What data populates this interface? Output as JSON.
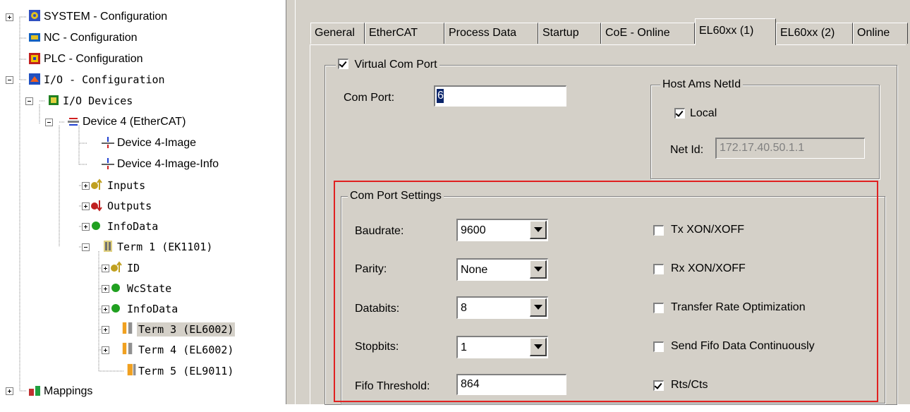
{
  "tree": {
    "items": [
      {
        "label": "SYSTEM - Configuration"
      },
      {
        "label": "NC - Configuration"
      },
      {
        "label": "PLC - Configuration"
      },
      {
        "label": "I/O - Configuration"
      },
      {
        "label": "I/O Devices"
      },
      {
        "label": "Device 4 (EtherCAT)"
      },
      {
        "label": "Device 4-Image"
      },
      {
        "label": "Device 4-Image-Info"
      },
      {
        "label": "Inputs"
      },
      {
        "label": "Outputs"
      },
      {
        "label": "InfoData"
      },
      {
        "label": "Term 1 (EK1101)"
      },
      {
        "label": "ID"
      },
      {
        "label": "WcState"
      },
      {
        "label": "InfoData"
      },
      {
        "label": "Term 3 (EL6002)"
      },
      {
        "label": "Term 4 (EL6002)"
      },
      {
        "label": "Term 5 (EL9011)"
      },
      {
        "label": "Mappings"
      }
    ]
  },
  "tabs": [
    "General",
    "EtherCAT",
    "Process Data",
    "Startup",
    "CoE - Online",
    "EL60xx (1)",
    "EL60xx (2)",
    "Online"
  ],
  "active_tab": "EL60xx (1)",
  "virtual_com_port": {
    "label": "Virtual Com Port",
    "checked": true
  },
  "com_port": {
    "label": "Com Port:",
    "value": "6"
  },
  "host_ams": {
    "title": "Host Ams NetId",
    "local_label": "Local",
    "local_checked": true,
    "netid_label": "Net Id:",
    "netid_value": "172.17.40.50.1.1"
  },
  "settings": {
    "title": "Com Port Settings",
    "baudrate": {
      "label": "Baudrate:",
      "value": "9600"
    },
    "parity": {
      "label": "Parity:",
      "value": "None"
    },
    "databits": {
      "label": "Databits:",
      "value": "8"
    },
    "stopbits": {
      "label": "Stopbits:",
      "value": "1"
    },
    "fifo": {
      "label": "Fifo Threshold:",
      "value": "864"
    },
    "options": [
      {
        "label": "Tx XON/XOFF",
        "checked": false
      },
      {
        "label": "Rx XON/XOFF",
        "checked": false
      },
      {
        "label": "Transfer Rate Optimization",
        "checked": false
      },
      {
        "label": "Send Fifo Data  Continuously",
        "checked": false
      },
      {
        "label": "Rts/Cts",
        "checked": true
      }
    ]
  },
  "colors": {
    "highlight": "#e02020",
    "dialog_bg": "#d4d0c8",
    "selection": "#0a246a"
  }
}
